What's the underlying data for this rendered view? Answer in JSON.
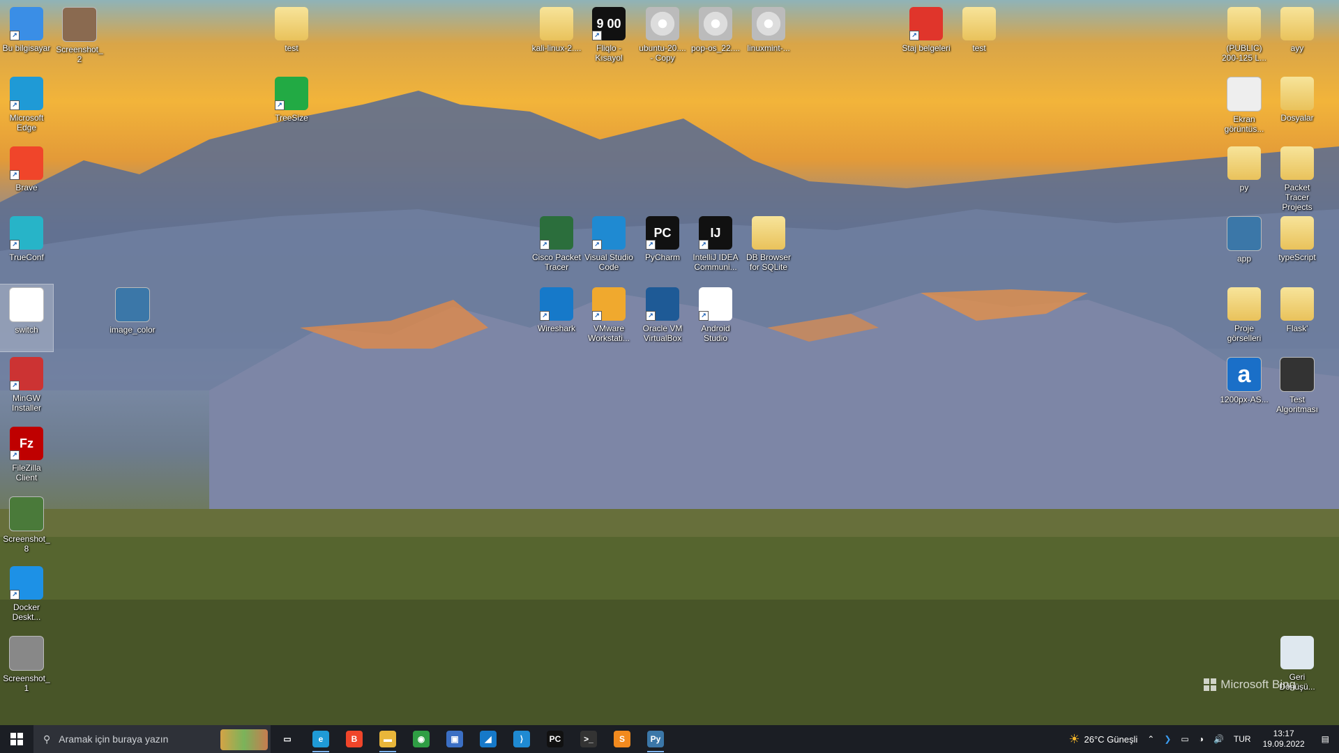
{
  "desktop": {
    "icons": [
      {
        "label": "Bu bilgisayar",
        "icon": "computer-icon",
        "color": "#3a8ee6"
      },
      {
        "label": "Screenshot_2",
        "icon": "image-thumbnail-icon",
        "color": "#8a6a50"
      },
      {
        "label": "test",
        "icon": "folder-zip-icon",
        "color": "#e9c25b"
      },
      {
        "label": "kali-linux-2....",
        "icon": "folder-icon",
        "color": "#e9c25b"
      },
      {
        "label": "Fliqlo - Kısayol",
        "icon": "clock-icon",
        "color": "#111111",
        "glyph": "9 00"
      },
      {
        "label": "ubuntu-20.... - Copy",
        "icon": "disc-image-icon",
        "color": "#cccccc"
      },
      {
        "label": "pop-os_22....",
        "icon": "disc-image-icon",
        "color": "#cccccc"
      },
      {
        "label": "linuxmint-...",
        "icon": "disc-image-icon",
        "color": "#cccccc"
      },
      {
        "label": "Staj belgeleri",
        "icon": "power-icon",
        "color": "#e0352b"
      },
      {
        "label": "test",
        "icon": "folder-icon",
        "color": "#e9c25b"
      },
      {
        "label": "(PUBLIC) 200-125 L...",
        "icon": "folder-icon",
        "color": "#e9c25b"
      },
      {
        "label": "ayy",
        "icon": "folder-zip-icon",
        "color": "#e9c25b"
      },
      {
        "label": "Microsoft Edge",
        "icon": "edge-icon",
        "color": "#1f9ad6"
      },
      {
        "label": "TreeSize",
        "icon": "treesize-icon",
        "color": "#22aa44"
      },
      {
        "label": "Ekran görüntüs...",
        "icon": "image-thumbnail-icon",
        "color": "#eeeeee"
      },
      {
        "label": "Dosyalar",
        "icon": "folder-icon",
        "color": "#e9c25b"
      },
      {
        "label": "Brave",
        "icon": "brave-icon",
        "color": "#f0452a"
      },
      {
        "label": "py",
        "icon": "folder-icon",
        "color": "#e9c25b"
      },
      {
        "label": "Packet Tracer Projects",
        "icon": "folder-icon",
        "color": "#e9c25b"
      },
      {
        "label": "TrueConf",
        "icon": "trueconf-icon",
        "color": "#27b4c8"
      },
      {
        "label": "Cisco Packet Tracer",
        "icon": "packet-tracer-icon",
        "color": "#2b6e3c"
      },
      {
        "label": "Visual Studio Code",
        "icon": "vscode-icon",
        "color": "#1f8ad2"
      },
      {
        "label": "PyCharm",
        "icon": "pycharm-icon",
        "color": "#111111",
        "glyph": "PC"
      },
      {
        "label": "IntelliJ IDEA Communi...",
        "icon": "intellij-icon",
        "color": "#111111",
        "glyph": "IJ"
      },
      {
        "label": "DB Browser for SQLite",
        "icon": "folder-icon",
        "color": "#e9c25b"
      },
      {
        "label": "app",
        "icon": "python-file-icon",
        "color": "#3b77a8"
      },
      {
        "label": "typeScript",
        "icon": "folder-icon",
        "color": "#e9c25b"
      },
      {
        "label": "switch",
        "icon": "image-thumbnail-icon",
        "color": "#ffffff"
      },
      {
        "label": "image_color",
        "icon": "python-file-icon",
        "color": "#3b77a8"
      },
      {
        "label": "Wireshark",
        "icon": "wireshark-icon",
        "color": "#1679c9"
      },
      {
        "label": "VMware Workstati...",
        "icon": "vmware-icon",
        "color": "#f0a92e"
      },
      {
        "label": "Oracle VM VirtualBox",
        "icon": "virtualbox-icon",
        "color": "#1e5a96"
      },
      {
        "label": "Android Studio",
        "icon": "android-studio-icon",
        "color": "#ffffff"
      },
      {
        "label": "Proje görselleri",
        "icon": "folder-icon",
        "color": "#e9c25b"
      },
      {
        "label": "Flask'",
        "icon": "folder-icon",
        "color": "#e9c25b"
      },
      {
        "label": "MinGW Installer",
        "icon": "installer-icon",
        "color": "#cc3333"
      },
      {
        "label": "1200px-AS...",
        "icon": "image-thumbnail-icon",
        "color": "#1a6fc8",
        "glyph": "a"
      },
      {
        "label": "Test Algoritması",
        "icon": "image-thumbnail-icon",
        "color": "#333333"
      },
      {
        "label": "FileZilla Client",
        "icon": "filezilla-icon",
        "color": "#bf0000",
        "glyph": "Fz"
      },
      {
        "label": "Screenshot_8",
        "icon": "image-thumbnail-icon",
        "color": "#4a7a3a"
      },
      {
        "label": "Docker Deskt...",
        "icon": "docker-icon",
        "color": "#1d91e6"
      },
      {
        "label": "Screenshot_1",
        "icon": "image-thumbnail-icon",
        "color": "#888888"
      },
      {
        "label": "Geri Dönüşü...",
        "icon": "recycle-bin-icon",
        "color": "#dfe8ef"
      }
    ],
    "watermark": "Microsoft Bing"
  },
  "taskbar": {
    "search_placeholder": "Aramak için buraya yazın",
    "apps": [
      {
        "name": "task-view-icon",
        "color": "#1b1e24",
        "glyph": "▭"
      },
      {
        "name": "edge-icon",
        "color": "#1f9ad6",
        "glyph": "e"
      },
      {
        "name": "brave-icon",
        "color": "#f0452a",
        "glyph": "B"
      },
      {
        "name": "file-explorer-icon",
        "color": "#e9b63a",
        "glyph": "▬"
      },
      {
        "name": "chrome-icon",
        "color": "#2f9e44",
        "glyph": "◉"
      },
      {
        "name": "remote-desktop-icon",
        "color": "#3b6fc4",
        "glyph": "▣"
      },
      {
        "name": "wireshark-icon",
        "color": "#1679c9",
        "glyph": "◢"
      },
      {
        "name": "vscode-icon",
        "color": "#1f8ad2",
        "glyph": "⟩"
      },
      {
        "name": "pycharm-icon",
        "color": "#111111",
        "glyph": "PC"
      },
      {
        "name": "terminal-icon",
        "color": "#333333",
        "glyph": ">_"
      },
      {
        "name": "sublime-icon",
        "color": "#f28a1e",
        "glyph": "S"
      },
      {
        "name": "python-icon",
        "color": "#3b77a8",
        "glyph": "Py"
      }
    ],
    "weather": "26°C  Güneşli",
    "language": "TUR",
    "time": "13:17",
    "date": "19.09.2022"
  }
}
